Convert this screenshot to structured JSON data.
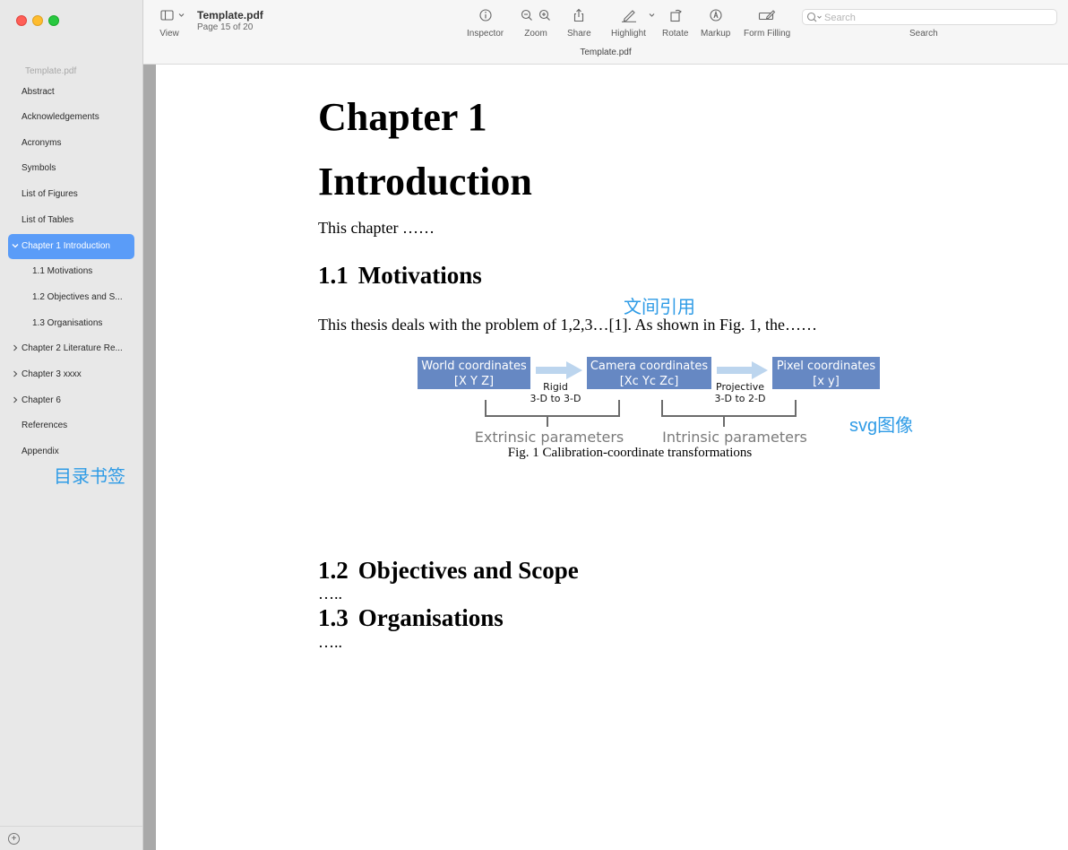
{
  "window": {
    "doc_name": "Template.pdf",
    "page_info": "Page 15 of 20",
    "tab_title": "Template.pdf"
  },
  "sidebar": {
    "doc_title": "Template.pdf",
    "items": [
      {
        "label": "Abstract"
      },
      {
        "label": "Acknowledgements"
      },
      {
        "label": "Acronyms"
      },
      {
        "label": "Symbols"
      },
      {
        "label": "List of Figures"
      },
      {
        "label": "List of Tables"
      },
      {
        "label": "Chapter 1 Introduction",
        "expanded": true,
        "selected": true
      },
      {
        "label": "1.1 Motivations"
      },
      {
        "label": "1.2 Objectives and S..."
      },
      {
        "label": "1.3 Organisations"
      },
      {
        "label": "Chapter 2 Literature Re...",
        "expanded": false
      },
      {
        "label": "Chapter 3 xxxx",
        "expanded": false
      },
      {
        "label": "Chapter 6",
        "expanded": false
      },
      {
        "label": "References"
      },
      {
        "label": "Appendix"
      }
    ],
    "annotation": "目录书签",
    "accent_color": "#5a9cf8"
  },
  "toolbar": {
    "view_label": "View",
    "inspector_label": "Inspector",
    "zoom_label": "Zoom",
    "share_label": "Share",
    "highlight_label": "Highlight",
    "rotate_label": "Rotate",
    "markup_label": "Markup",
    "form_filling_label": "Form Filling",
    "search_label": "Search",
    "search_placeholder": "Search"
  },
  "document": {
    "chapter_heading": "Chapter 1",
    "chapter_title": "Introduction",
    "intro_text": "This chapter ……",
    "sections": [
      {
        "num": "1.1",
        "title": "Motivations"
      },
      {
        "num": "1.2",
        "title": "Objectives and Scope"
      },
      {
        "num": "1.3",
        "title": "Organisations"
      }
    ],
    "motivation_text": "This thesis deals with the problem of 1,2,3…[1]. As shown in Fig. 1, the……",
    "placeholder_ellipsis": "…..",
    "annotation_citation": "文间引用",
    "annotation_svg": "svg图像",
    "annotation_color": "#2e9be6"
  },
  "figure": {
    "boxes": [
      {
        "line1": "World coordinates",
        "line2": "[X Y Z]"
      },
      {
        "line1": "Camera coordinates",
        "line2": "[Xc Yc Zc]"
      },
      {
        "line1": "Pixel coordinates",
        "line2": "[x y]"
      }
    ],
    "arrows": [
      {
        "line1": "Rigid",
        "line2": "3-D to 3-D"
      },
      {
        "line1": "Projective",
        "line2": "3-D to 2-D"
      }
    ],
    "braces": [
      {
        "label": "Extrinsic parameters"
      },
      {
        "label": "Intrinsic parameters"
      }
    ],
    "caption": "Fig. 1 Calibration-coordinate transformations",
    "box_color": "#6688c3",
    "arrow_color": "#bcd5ee"
  }
}
